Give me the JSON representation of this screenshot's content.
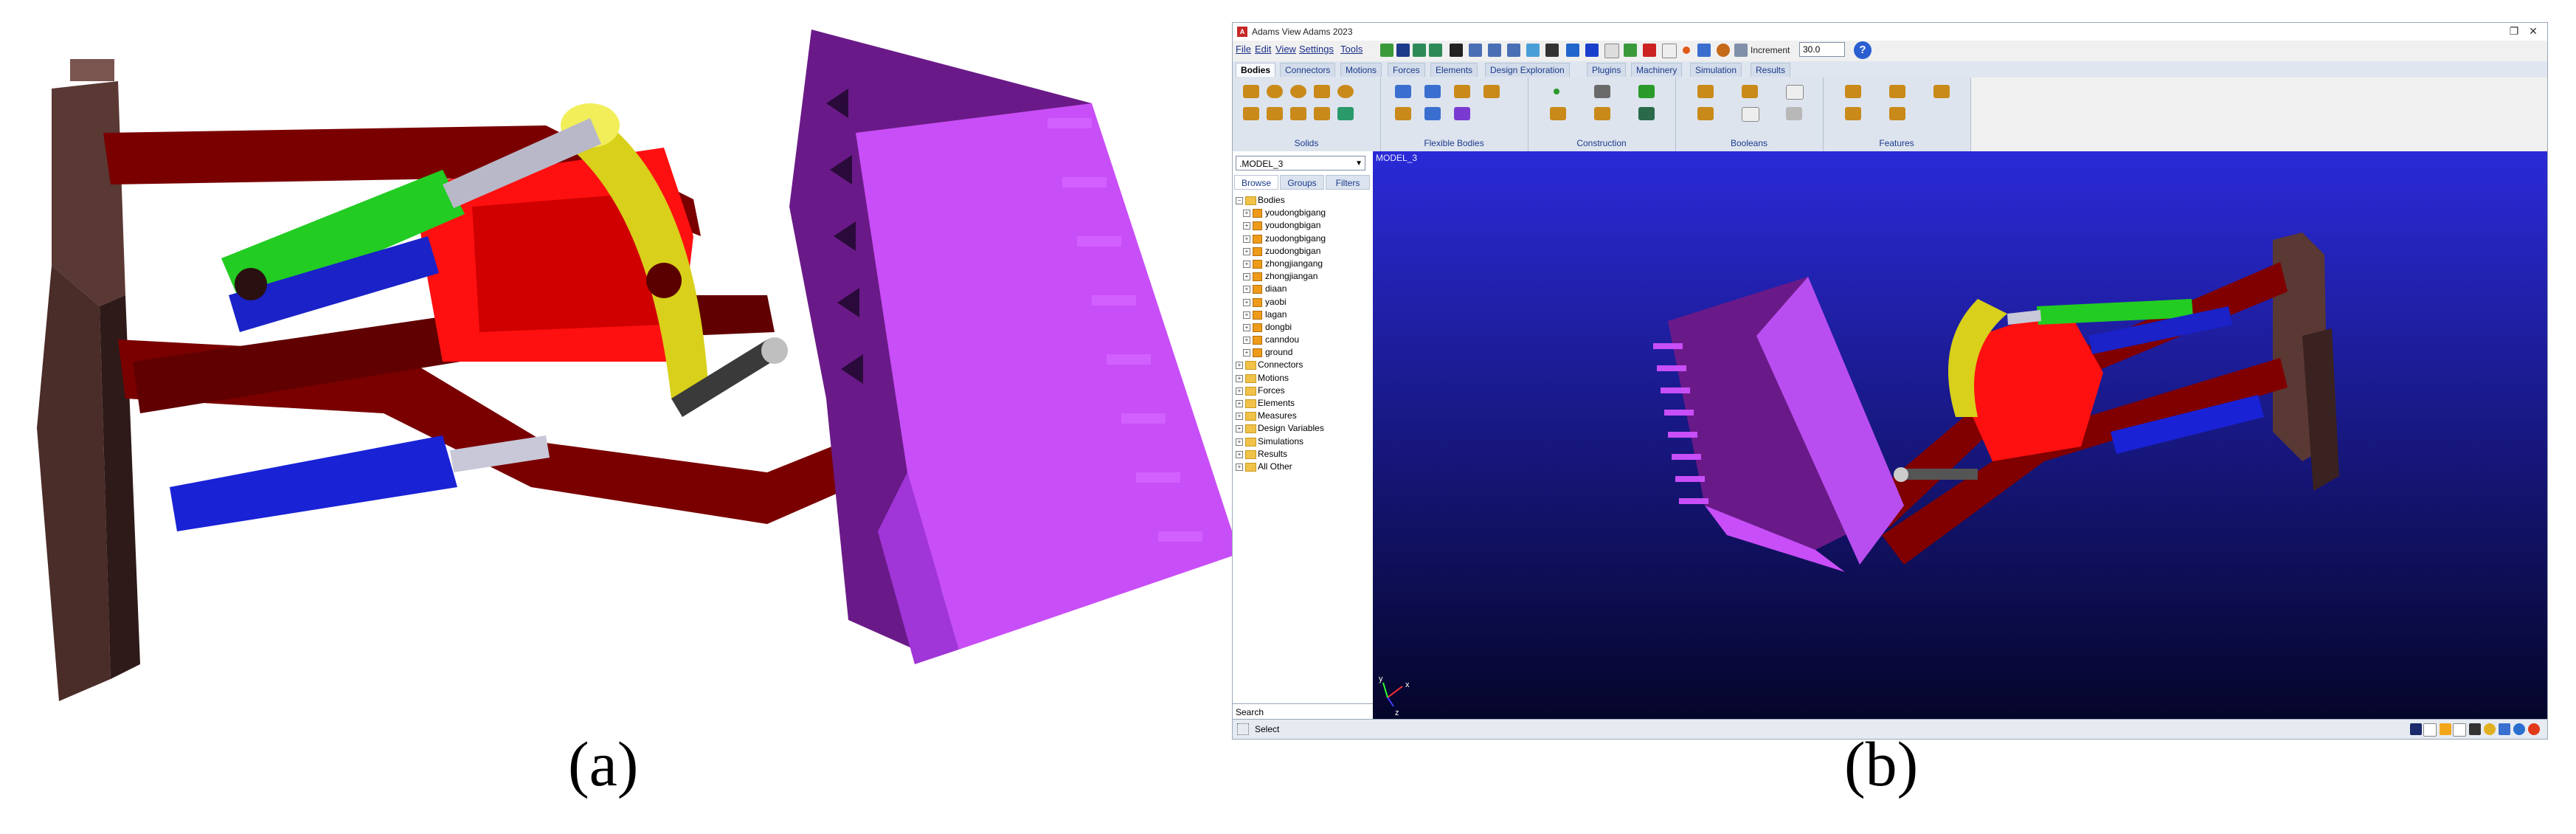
{
  "captions": {
    "a": "(a)",
    "b": "(b)"
  },
  "window": {
    "title": "Adams View Adams 2023",
    "controls": {
      "restore": "❐",
      "close": "✕"
    }
  },
  "menu": [
    "File",
    "Edit",
    "View",
    "Settings",
    "Tools"
  ],
  "toolbar": {
    "increment_label": "Increment",
    "increment_value": "30.0"
  },
  "tabs": [
    "Bodies",
    "Connectors",
    "Motions",
    "Forces",
    "Elements",
    "Design Exploration",
    "Plugins",
    "Machinery",
    "Simulation",
    "Results"
  ],
  "ribbon_groups": [
    "Solids",
    "Flexible Bodies",
    "Construction",
    "Booleans",
    "Features"
  ],
  "model_select": ".MODEL_3",
  "browse_tabs": [
    "Browse",
    "Groups",
    "Filters"
  ],
  "tree": [
    {
      "label": "Bodies",
      "toggle": "−",
      "level": 0,
      "kind": "folder"
    },
    {
      "label": "youdongbigang",
      "toggle": "+",
      "level": 1,
      "kind": "part"
    },
    {
      "label": "youdongbigan",
      "toggle": "+",
      "level": 1,
      "kind": "part"
    },
    {
      "label": "zuodongbigang",
      "toggle": "+",
      "level": 1,
      "kind": "part"
    },
    {
      "label": "zuodongbigan",
      "toggle": "+",
      "level": 1,
      "kind": "part"
    },
    {
      "label": "zhongjiangang",
      "toggle": "+",
      "level": 1,
      "kind": "part"
    },
    {
      "label": "zhongjiangan",
      "toggle": "+",
      "level": 1,
      "kind": "part"
    },
    {
      "label": "diaan",
      "toggle": "+",
      "level": 1,
      "kind": "part"
    },
    {
      "label": "yaobi",
      "toggle": "+",
      "level": 1,
      "kind": "part"
    },
    {
      "label": "lagan",
      "toggle": "+",
      "level": 1,
      "kind": "part"
    },
    {
      "label": "dongbi",
      "toggle": "+",
      "level": 1,
      "kind": "part"
    },
    {
      "label": "canndou",
      "toggle": "+",
      "level": 1,
      "kind": "part"
    },
    {
      "label": "ground",
      "toggle": "+",
      "level": 1,
      "kind": "part"
    },
    {
      "label": "Connectors",
      "toggle": "+",
      "level": 0,
      "kind": "folder"
    },
    {
      "label": "Motions",
      "toggle": "+",
      "level": 0,
      "kind": "folder"
    },
    {
      "label": "Forces",
      "toggle": "+",
      "level": 0,
      "kind": "folder"
    },
    {
      "label": "Elements",
      "toggle": "+",
      "level": 0,
      "kind": "folder"
    },
    {
      "label": "Measures",
      "toggle": "+",
      "level": 0,
      "kind": "folder"
    },
    {
      "label": "Design Variables",
      "toggle": "+",
      "level": 0,
      "kind": "folder"
    },
    {
      "label": "Simulations",
      "toggle": "+",
      "level": 0,
      "kind": "folder"
    },
    {
      "label": "Results",
      "toggle": "+",
      "level": 0,
      "kind": "folder"
    },
    {
      "label": "All Other",
      "toggle": "+",
      "level": 0,
      "kind": "folder"
    }
  ],
  "search_label": "Search",
  "viewport_label": "MODEL_3",
  "triad_labels": {
    "x": "x",
    "y": "y",
    "z": "z"
  },
  "status_text": "Select",
  "colors": {
    "bucket": "#b94ef0",
    "boom": "#8b0000",
    "rocker": "#ff1a1a",
    "cylinder_blue": "#1a2bd6",
    "cylinder_green": "#2bd62b",
    "linkage_yellow": "#d9d21a",
    "frame": "#5a3a34",
    "viewport_top": "#2a2ad8",
    "viewport_bottom": "#05052a"
  }
}
